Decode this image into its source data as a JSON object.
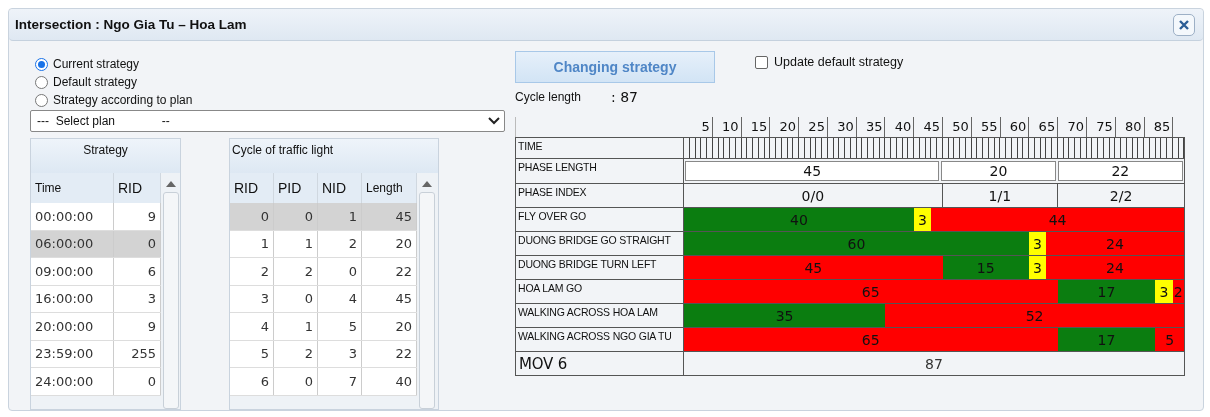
{
  "window": {
    "title": "Intersection : Ngo Gia Tu – Hoa Lam"
  },
  "strategy_options": [
    {
      "label": "Current strategy",
      "selected": true
    },
    {
      "label": "Default strategy",
      "selected": false
    },
    {
      "label": "Strategy according to plan",
      "selected": false
    }
  ],
  "plan_select": {
    "value": "---  Select plan              --"
  },
  "strategy_table": {
    "title": "Strategy",
    "columns": [
      "Time",
      "RID"
    ],
    "rows": [
      {
        "cells": [
          "00:00:00",
          "9"
        ],
        "selected": false
      },
      {
        "cells": [
          "06:00:00",
          "0"
        ],
        "selected": true
      },
      {
        "cells": [
          "09:00:00",
          "6"
        ],
        "selected": false
      },
      {
        "cells": [
          "16:00:00",
          "3"
        ],
        "selected": false
      },
      {
        "cells": [
          "20:00:00",
          "9"
        ],
        "selected": false
      },
      {
        "cells": [
          "23:59:00",
          "255"
        ],
        "selected": false
      },
      {
        "cells": [
          "24:00:00",
          "0"
        ],
        "selected": false
      }
    ]
  },
  "cycle_table": {
    "title": "Cycle of traffic light",
    "columns": [
      "RID",
      "PID",
      "NID",
      "Length"
    ],
    "rows": [
      {
        "cells": [
          "0",
          "0",
          "1",
          "45"
        ],
        "selected": true
      },
      {
        "cells": [
          "1",
          "1",
          "2",
          "20"
        ],
        "selected": false
      },
      {
        "cells": [
          "2",
          "2",
          "0",
          "22"
        ],
        "selected": false
      },
      {
        "cells": [
          "3",
          "0",
          "4",
          "45"
        ],
        "selected": false
      },
      {
        "cells": [
          "4",
          "1",
          "5",
          "20"
        ],
        "selected": false
      },
      {
        "cells": [
          "5",
          "2",
          "3",
          "22"
        ],
        "selected": false
      },
      {
        "cells": [
          "6",
          "0",
          "7",
          "40"
        ],
        "selected": false
      }
    ]
  },
  "changing_button": "Changing strategy",
  "update_default": {
    "label": "Update default strategy",
    "checked": false
  },
  "cycle_length": {
    "label": "Cycle length",
    "value": ": 87"
  },
  "timing": {
    "ticks": [
      "5",
      "10",
      "15",
      "20",
      "25",
      "30",
      "35",
      "40",
      "45",
      "50",
      "55",
      "60",
      "65",
      "70",
      "75",
      "80",
      "85"
    ],
    "time_label": "TIME",
    "phase_length": {
      "label": "PHASE LENGTH",
      "values": [
        "45",
        "20",
        "22"
      ]
    },
    "phase_index": {
      "label": "PHASE INDEX",
      "values": [
        "0/0",
        "1/1",
        "2/2"
      ]
    },
    "movements": [
      {
        "name": "FLY OVER GO",
        "segments": [
          {
            "value": "40",
            "kind": "green"
          },
          {
            "value": "3",
            "kind": "yellow"
          },
          {
            "value": "44",
            "kind": "red"
          }
        ]
      },
      {
        "name": "DUONG BRIDGE GO STRAIGHT",
        "segments": [
          {
            "value": "60",
            "kind": "green"
          },
          {
            "value": "3",
            "kind": "yellow"
          },
          {
            "value": "24",
            "kind": "red"
          }
        ]
      },
      {
        "name": "DUONG BRIDGE TURN LEFT",
        "segments": [
          {
            "value": "45",
            "kind": "red"
          },
          {
            "value": "15",
            "kind": "green"
          },
          {
            "value": "3",
            "kind": "yellow"
          },
          {
            "value": "24",
            "kind": "red"
          }
        ]
      },
      {
        "name": "HOA LAM GO",
        "segments": [
          {
            "value": "65",
            "kind": "red"
          },
          {
            "value": "17",
            "kind": "green"
          },
          {
            "value": "3",
            "kind": "yellow"
          },
          {
            "value": "2",
            "kind": "red"
          }
        ]
      },
      {
        "name": "WALKING ACROSS HOA LAM",
        "segments": [
          {
            "value": "35",
            "kind": "green"
          },
          {
            "value": "52",
            "kind": "red"
          }
        ]
      },
      {
        "name": "WALKING ACROSS NGO GIA TU",
        "segments": [
          {
            "value": "65",
            "kind": "red"
          },
          {
            "value": "17",
            "kind": "green"
          },
          {
            "value": "5",
            "kind": "red"
          }
        ]
      }
    ],
    "total": {
      "label": "MOV 6",
      "value": "87"
    }
  }
}
